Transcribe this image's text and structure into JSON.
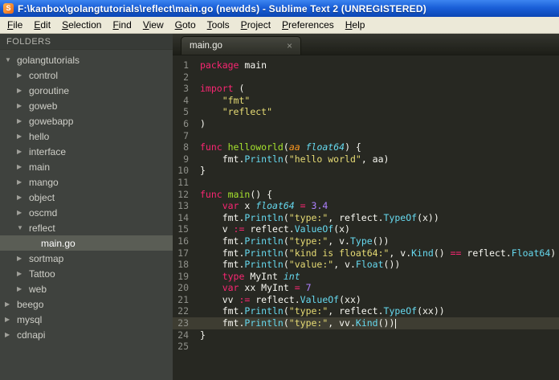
{
  "window": {
    "title": "F:\\kanbox\\golangtutorials\\reflect\\main.go (newdds) - Sublime Text 2 (UNREGISTERED)"
  },
  "menu": {
    "items": [
      "File",
      "Edit",
      "Selection",
      "Find",
      "View",
      "Goto",
      "Tools",
      "Project",
      "Preferences",
      "Help"
    ]
  },
  "sidebar": {
    "header": "FOLDERS",
    "items": [
      {
        "label": "golangtutorials",
        "depth": 0,
        "expanded": true,
        "file": false,
        "selected": false
      },
      {
        "label": "control",
        "depth": 1,
        "expanded": false,
        "file": false,
        "selected": false
      },
      {
        "label": "goroutine",
        "depth": 1,
        "expanded": false,
        "file": false,
        "selected": false
      },
      {
        "label": "goweb",
        "depth": 1,
        "expanded": false,
        "file": false,
        "selected": false
      },
      {
        "label": "gowebapp",
        "depth": 1,
        "expanded": false,
        "file": false,
        "selected": false
      },
      {
        "label": "hello",
        "depth": 1,
        "expanded": false,
        "file": false,
        "selected": false
      },
      {
        "label": "interface",
        "depth": 1,
        "expanded": false,
        "file": false,
        "selected": false
      },
      {
        "label": "main",
        "depth": 1,
        "expanded": false,
        "file": false,
        "selected": false
      },
      {
        "label": "mango",
        "depth": 1,
        "expanded": false,
        "file": false,
        "selected": false
      },
      {
        "label": "object",
        "depth": 1,
        "expanded": false,
        "file": false,
        "selected": false
      },
      {
        "label": "oscmd",
        "depth": 1,
        "expanded": false,
        "file": false,
        "selected": false
      },
      {
        "label": "reflect",
        "depth": 1,
        "expanded": true,
        "file": false,
        "selected": false
      },
      {
        "label": "main.go",
        "depth": 2,
        "expanded": false,
        "file": true,
        "selected": true
      },
      {
        "label": "sortmap",
        "depth": 1,
        "expanded": false,
        "file": false,
        "selected": false
      },
      {
        "label": "Tattoo",
        "depth": 1,
        "expanded": false,
        "file": false,
        "selected": false
      },
      {
        "label": "web",
        "depth": 1,
        "expanded": false,
        "file": false,
        "selected": false
      },
      {
        "label": "beego",
        "depth": 0,
        "expanded": false,
        "file": false,
        "selected": false
      },
      {
        "label": "mysql",
        "depth": 0,
        "expanded": false,
        "file": false,
        "selected": false
      },
      {
        "label": "cdnapi",
        "depth": 0,
        "expanded": false,
        "file": false,
        "selected": false
      }
    ]
  },
  "tabs": [
    {
      "label": "main.go",
      "active": true,
      "close_glyph": "×"
    }
  ],
  "editor": {
    "lines": [
      {
        "num": 1,
        "tokens": [
          [
            "k",
            "package"
          ],
          [
            "p",
            " main"
          ]
        ]
      },
      {
        "num": 2,
        "tokens": []
      },
      {
        "num": 3,
        "tokens": [
          [
            "k",
            "import"
          ],
          [
            "p",
            " ("
          ]
        ]
      },
      {
        "num": 4,
        "tokens": [
          [
            "p",
            "    "
          ],
          [
            "s",
            "\"fmt\""
          ]
        ]
      },
      {
        "num": 5,
        "tokens": [
          [
            "p",
            "    "
          ],
          [
            "s",
            "\"reflect\""
          ]
        ]
      },
      {
        "num": 6,
        "tokens": [
          [
            "p",
            ")"
          ]
        ]
      },
      {
        "num": 7,
        "tokens": []
      },
      {
        "num": 8,
        "tokens": [
          [
            "k",
            "func "
          ],
          [
            "g",
            "helloworld"
          ],
          [
            "p",
            "("
          ],
          [
            "a",
            "aa "
          ],
          [
            "t",
            "float64"
          ],
          [
            "p",
            ") {"
          ]
        ]
      },
      {
        "num": 9,
        "tokens": [
          [
            "p",
            "    fmt."
          ],
          [
            "f",
            "Println"
          ],
          [
            "p",
            "("
          ],
          [
            "s",
            "\"hello world\""
          ],
          [
            "p",
            ", aa)"
          ]
        ]
      },
      {
        "num": 10,
        "tokens": [
          [
            "p",
            "}"
          ]
        ]
      },
      {
        "num": 11,
        "tokens": []
      },
      {
        "num": 12,
        "tokens": [
          [
            "k",
            "func "
          ],
          [
            "g",
            "main"
          ],
          [
            "p",
            "() {"
          ]
        ]
      },
      {
        "num": 13,
        "tokens": [
          [
            "p",
            "    "
          ],
          [
            "k",
            "var"
          ],
          [
            "p",
            " x "
          ],
          [
            "t",
            "float64"
          ],
          [
            "p",
            " "
          ],
          [
            "k",
            "="
          ],
          [
            "p",
            " "
          ],
          [
            "n",
            "3.4"
          ]
        ]
      },
      {
        "num": 14,
        "tokens": [
          [
            "p",
            "    fmt."
          ],
          [
            "f",
            "Println"
          ],
          [
            "p",
            "("
          ],
          [
            "s",
            "\"type:\""
          ],
          [
            "p",
            ", reflect."
          ],
          [
            "f",
            "TypeOf"
          ],
          [
            "p",
            "(x))"
          ]
        ]
      },
      {
        "num": 15,
        "tokens": [
          [
            "p",
            "    v "
          ],
          [
            "k",
            ":="
          ],
          [
            "p",
            " reflect."
          ],
          [
            "f",
            "ValueOf"
          ],
          [
            "p",
            "(x)"
          ]
        ]
      },
      {
        "num": 16,
        "tokens": [
          [
            "p",
            "    fmt."
          ],
          [
            "f",
            "Println"
          ],
          [
            "p",
            "("
          ],
          [
            "s",
            "\"type:\""
          ],
          [
            "p",
            ", v."
          ],
          [
            "f",
            "Type"
          ],
          [
            "p",
            "())"
          ]
        ]
      },
      {
        "num": 17,
        "tokens": [
          [
            "p",
            "    fmt."
          ],
          [
            "f",
            "Println"
          ],
          [
            "p",
            "("
          ],
          [
            "s",
            "\"kind is float64:\""
          ],
          [
            "p",
            ", v."
          ],
          [
            "f",
            "Kind"
          ],
          [
            "p",
            "() "
          ],
          [
            "k",
            "=="
          ],
          [
            "p",
            " reflect."
          ],
          [
            "f",
            "Float64"
          ],
          [
            "p",
            ")"
          ]
        ]
      },
      {
        "num": 18,
        "tokens": [
          [
            "p",
            "    fmt."
          ],
          [
            "f",
            "Println"
          ],
          [
            "p",
            "("
          ],
          [
            "s",
            "\"value:\""
          ],
          [
            "p",
            ", v."
          ],
          [
            "f",
            "Float"
          ],
          [
            "p",
            "())"
          ]
        ]
      },
      {
        "num": 19,
        "tokens": [
          [
            "p",
            "    "
          ],
          [
            "k",
            "type"
          ],
          [
            "p",
            " MyInt "
          ],
          [
            "t",
            "int"
          ]
        ]
      },
      {
        "num": 20,
        "tokens": [
          [
            "p",
            "    "
          ],
          [
            "k",
            "var"
          ],
          [
            "p",
            " xx MyInt "
          ],
          [
            "k",
            "="
          ],
          [
            "p",
            " "
          ],
          [
            "n",
            "7"
          ]
        ]
      },
      {
        "num": 21,
        "tokens": [
          [
            "p",
            "    vv "
          ],
          [
            "k",
            ":="
          ],
          [
            "p",
            " reflect."
          ],
          [
            "f",
            "ValueOf"
          ],
          [
            "p",
            "(xx)"
          ]
        ]
      },
      {
        "num": 22,
        "tokens": [
          [
            "p",
            "    fmt."
          ],
          [
            "f",
            "Println"
          ],
          [
            "p",
            "("
          ],
          [
            "s",
            "\"type:\""
          ],
          [
            "p",
            ", reflect."
          ],
          [
            "f",
            "TypeOf"
          ],
          [
            "p",
            "(xx))"
          ]
        ]
      },
      {
        "num": 23,
        "tokens": [
          [
            "p",
            "    fmt."
          ],
          [
            "f",
            "Println"
          ],
          [
            "p",
            "("
          ],
          [
            "s",
            "\"type:\""
          ],
          [
            "p",
            ", vv."
          ],
          [
            "f",
            "Kind"
          ],
          [
            "p",
            "())"
          ]
        ],
        "current": true,
        "cursor": true
      },
      {
        "num": 24,
        "tokens": [
          [
            "p",
            "}"
          ]
        ]
      },
      {
        "num": 25,
        "tokens": []
      }
    ]
  }
}
